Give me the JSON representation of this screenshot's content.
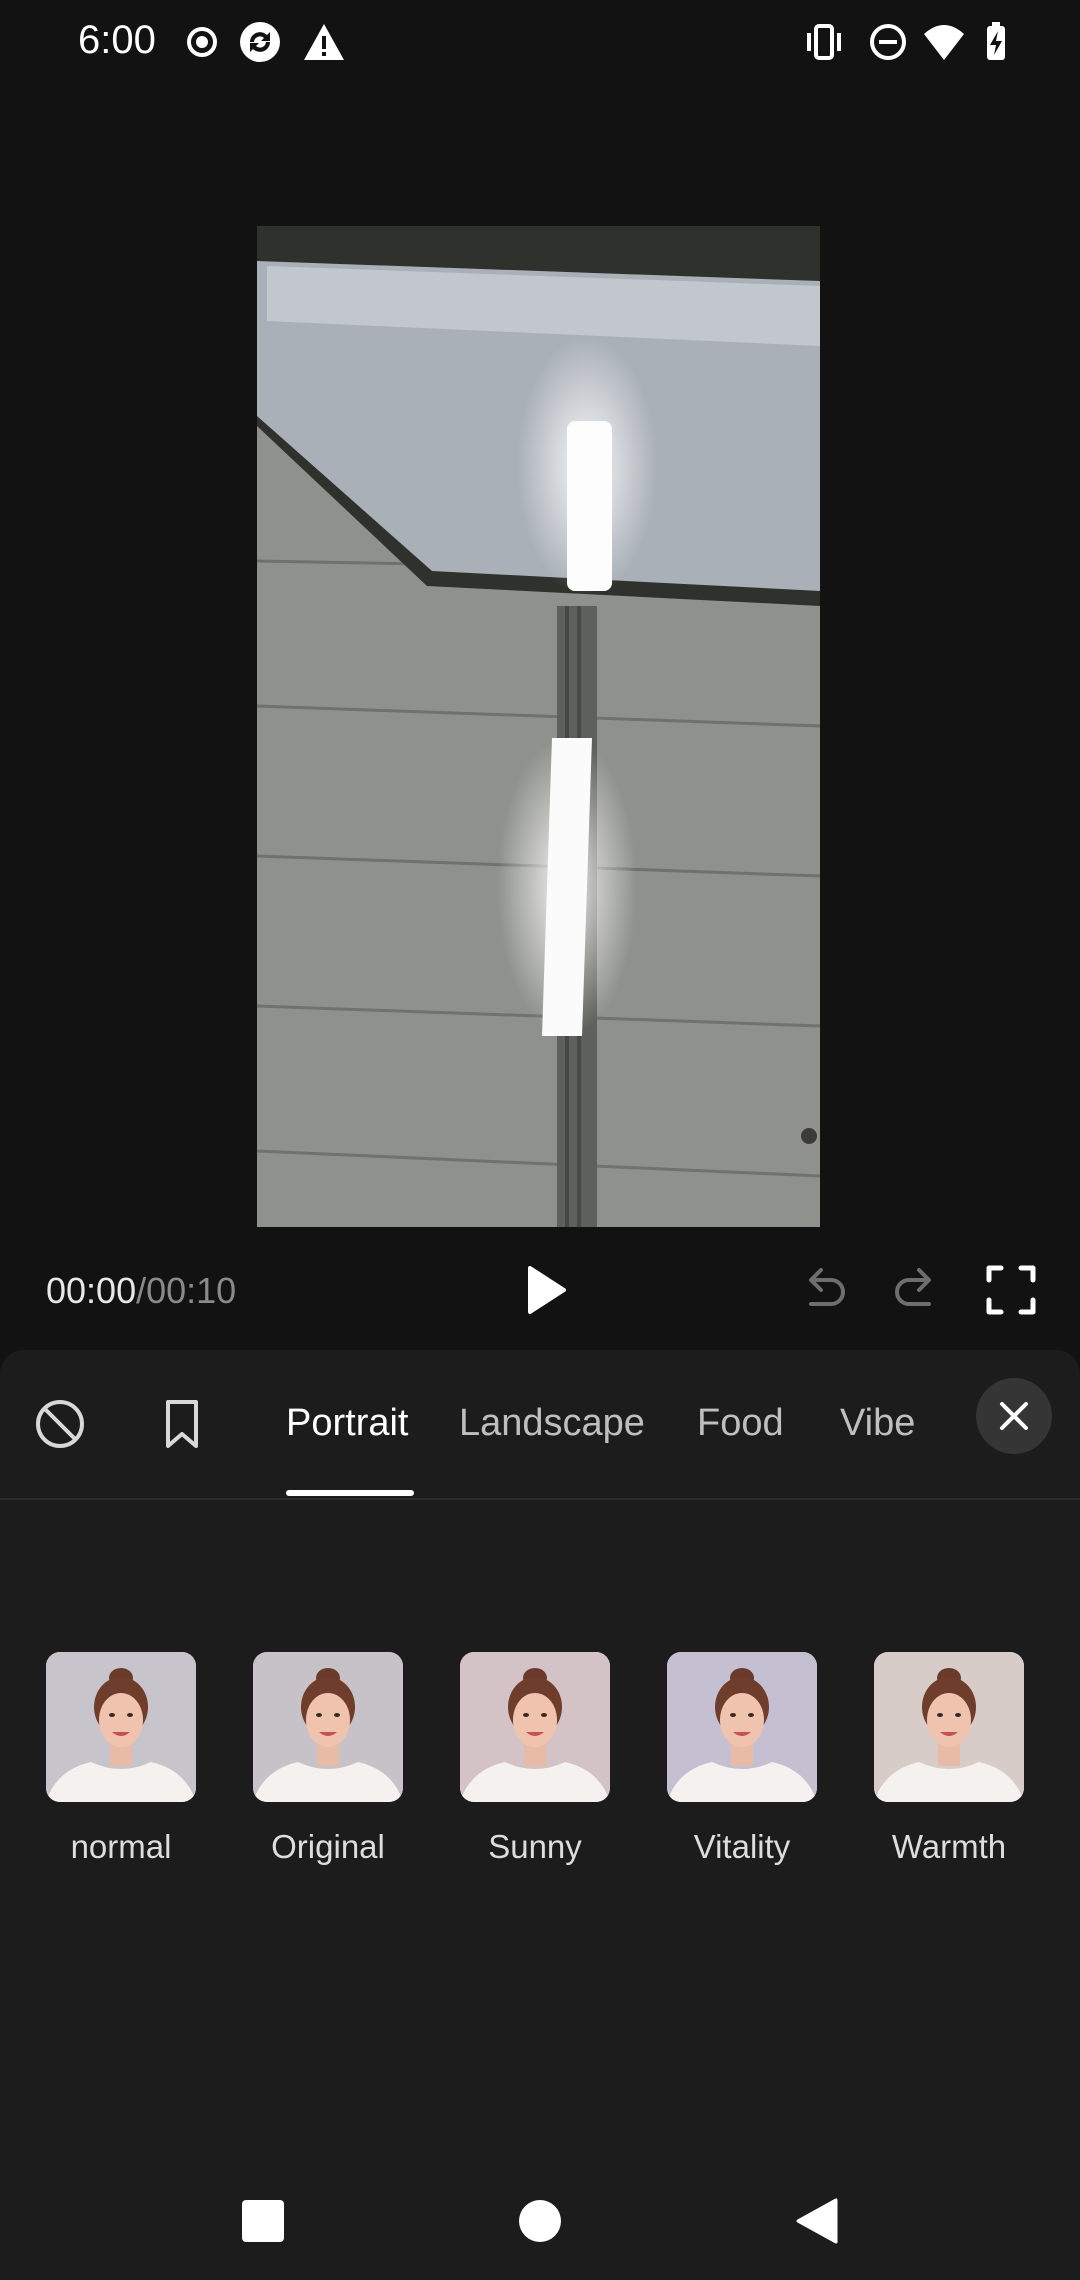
{
  "status_bar": {
    "time": "6:00",
    "left_icons": [
      "record-icon",
      "sync-icon",
      "warning-icon"
    ],
    "right_icons": [
      "vibrate-icon",
      "do-not-disturb-icon",
      "wifi-icon",
      "battery-charging-icon"
    ]
  },
  "player": {
    "current_time": "00:00",
    "separator": "/",
    "duration": "00:10",
    "controls": [
      "play-icon",
      "undo-icon",
      "redo-icon",
      "fullscreen-icon"
    ]
  },
  "filter_panel": {
    "tabs": [
      {
        "label": "Portrait",
        "active": true
      },
      {
        "label": "Landscape",
        "active": false
      },
      {
        "label": "Food",
        "active": false
      },
      {
        "label": "Vibe",
        "active": false
      }
    ],
    "filters": [
      {
        "label": "normal",
        "tint": "#c8c4cb"
      },
      {
        "label": "Original",
        "tint": "#c7c2c8"
      },
      {
        "label": "Sunny",
        "tint": "#d3c2c6"
      },
      {
        "label": "Vitality",
        "tint": "#c4c0d2"
      },
      {
        "label": "Warmth",
        "tint": "#d8ccc8"
      }
    ]
  },
  "nav_bar": {
    "buttons": [
      "recents-icon",
      "home-icon",
      "back-icon"
    ]
  }
}
